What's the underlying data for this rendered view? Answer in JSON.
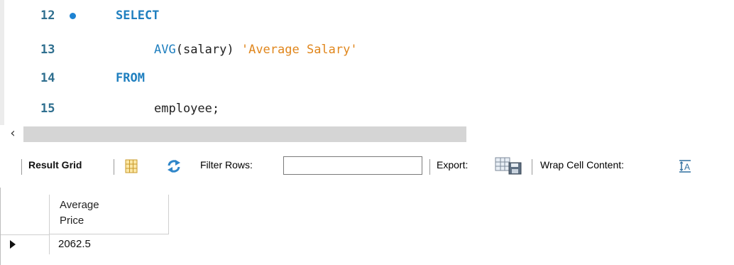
{
  "editor": {
    "lines": [
      {
        "num": "12",
        "executing": true,
        "tokens": [
          {
            "type": "kw",
            "text": "SELECT"
          }
        ]
      },
      {
        "num": "13",
        "executing": false,
        "tokens": [
          {
            "type": "fn",
            "text": "AVG"
          },
          {
            "type": "plain",
            "text": "(salary) "
          },
          {
            "type": "str",
            "text": "'Average Salary'"
          }
        ]
      },
      {
        "num": "14",
        "executing": false,
        "tokens": [
          {
            "type": "kw",
            "text": "FROM"
          }
        ]
      },
      {
        "num": "15",
        "executing": false,
        "tokens": [
          {
            "type": "plain",
            "text": "employee;"
          }
        ]
      }
    ],
    "scroll_left_icon": "chevron-left-icon"
  },
  "toolbar": {
    "result_grid_label": "Result Grid",
    "grid_layout_icon": "grid-layout-icon",
    "refresh_icon": "refresh-icon",
    "filter_label": "Filter Rows:",
    "filter_value": "",
    "export_label": "Export:",
    "export_icon": "export-icon",
    "wrap_label": "Wrap Cell Content:",
    "wrap_icon": "wrap-cell-icon"
  },
  "grid": {
    "columns": [
      "Average\nPrice"
    ],
    "rows": [
      [
        "2062.5"
      ]
    ]
  },
  "colors": {
    "keyword": "#1f7fbf",
    "string": "#e0861c",
    "line_number": "#2f6f8f",
    "exec_dot": "#1e82d2"
  }
}
